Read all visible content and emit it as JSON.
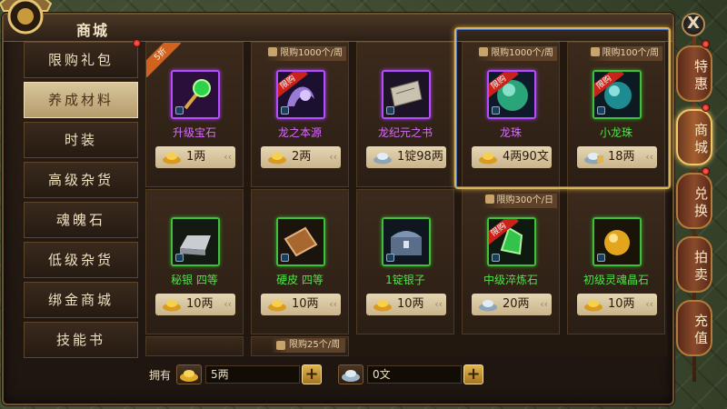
{
  "window": {
    "title": "商城",
    "close_label": "X"
  },
  "sidebar": {
    "items": [
      {
        "label": "限购礼包",
        "active": false,
        "badge": true
      },
      {
        "label": "养成材料",
        "active": true,
        "badge": false
      },
      {
        "label": "时装",
        "active": false,
        "badge": false
      },
      {
        "label": "高级杂货",
        "active": false,
        "badge": false
      },
      {
        "label": "魂魄石",
        "active": false,
        "badge": false
      },
      {
        "label": "低级杂货",
        "active": false,
        "badge": false
      },
      {
        "label": "绑金商城",
        "active": false,
        "badge": false
      },
      {
        "label": "技能书",
        "active": false,
        "badge": false
      }
    ]
  },
  "items": [
    {
      "name": "升级宝石",
      "price": "1两",
      "currency": "gold",
      "rarity": "purple",
      "icon": "gem-scepter-icon",
      "discount": "5折",
      "limit": "",
      "hot": false
    },
    {
      "name": "龙之本源",
      "price": "2两",
      "currency": "gold",
      "rarity": "purple",
      "icon": "dragon-orb-icon",
      "discount": "",
      "limit": "限购1000个/周",
      "hot": true
    },
    {
      "name": "龙纪元之书",
      "price": "1锭98两",
      "currency": "silver",
      "rarity": "purple",
      "icon": "scroll-icon",
      "discount": "",
      "limit": "",
      "hot": false
    },
    {
      "name": "龙珠",
      "price": "4两90文",
      "currency": "gold",
      "rarity": "purple",
      "icon": "dragon-pearl-icon",
      "discount": "",
      "limit": "限购1000个/周",
      "hot": true
    },
    {
      "name": "小龙珠",
      "price": "18两",
      "currency": "silver-lock",
      "rarity": "green",
      "icon": "small-dragon-pearl-icon",
      "discount": "",
      "limit": "限购100个/周",
      "hot": true
    },
    {
      "name": "秘银 四等",
      "price": "10两",
      "currency": "gold",
      "rarity": "green",
      "icon": "mithril-ingot-icon",
      "discount": "",
      "limit": "",
      "hot": false
    },
    {
      "name": "硬皮 四等",
      "price": "10两",
      "currency": "gold",
      "rarity": "green",
      "icon": "leather-icon",
      "discount": "",
      "limit": "",
      "hot": false
    },
    {
      "name": "1锭银子",
      "price": "10两",
      "currency": "gold",
      "rarity": "green",
      "icon": "silver-chest-icon",
      "discount": "",
      "limit": "",
      "hot": false
    },
    {
      "name": "中级淬炼石",
      "price": "20两",
      "currency": "silver",
      "rarity": "green",
      "icon": "green-crystal-icon",
      "discount": "",
      "limit": "限购300个/日",
      "hot": true
    },
    {
      "name": "初级灵魂晶石",
      "price": "10两",
      "currency": "gold",
      "rarity": "green",
      "icon": "soul-crystal-icon",
      "discount": "",
      "limit": "",
      "hot": false
    }
  ],
  "hot_label": "限购",
  "row3_limit": "限购25个/周",
  "bottom": {
    "own_label": "拥有",
    "gold_amount": "5两",
    "silver_amount": "0文",
    "plus_label": "+"
  },
  "right_tabs": [
    {
      "label": "特惠",
      "active": false,
      "badge": true
    },
    {
      "label": "商城",
      "active": true,
      "badge": true
    },
    {
      "label": "兑换",
      "active": false,
      "badge": true
    },
    {
      "label": "拍卖",
      "active": false,
      "badge": false
    },
    {
      "label": "充值",
      "active": false,
      "badge": false
    }
  ],
  "colors": {
    "purple": "#d86bff",
    "green": "#4fe34a",
    "accent_gold": "#d9b35c"
  }
}
